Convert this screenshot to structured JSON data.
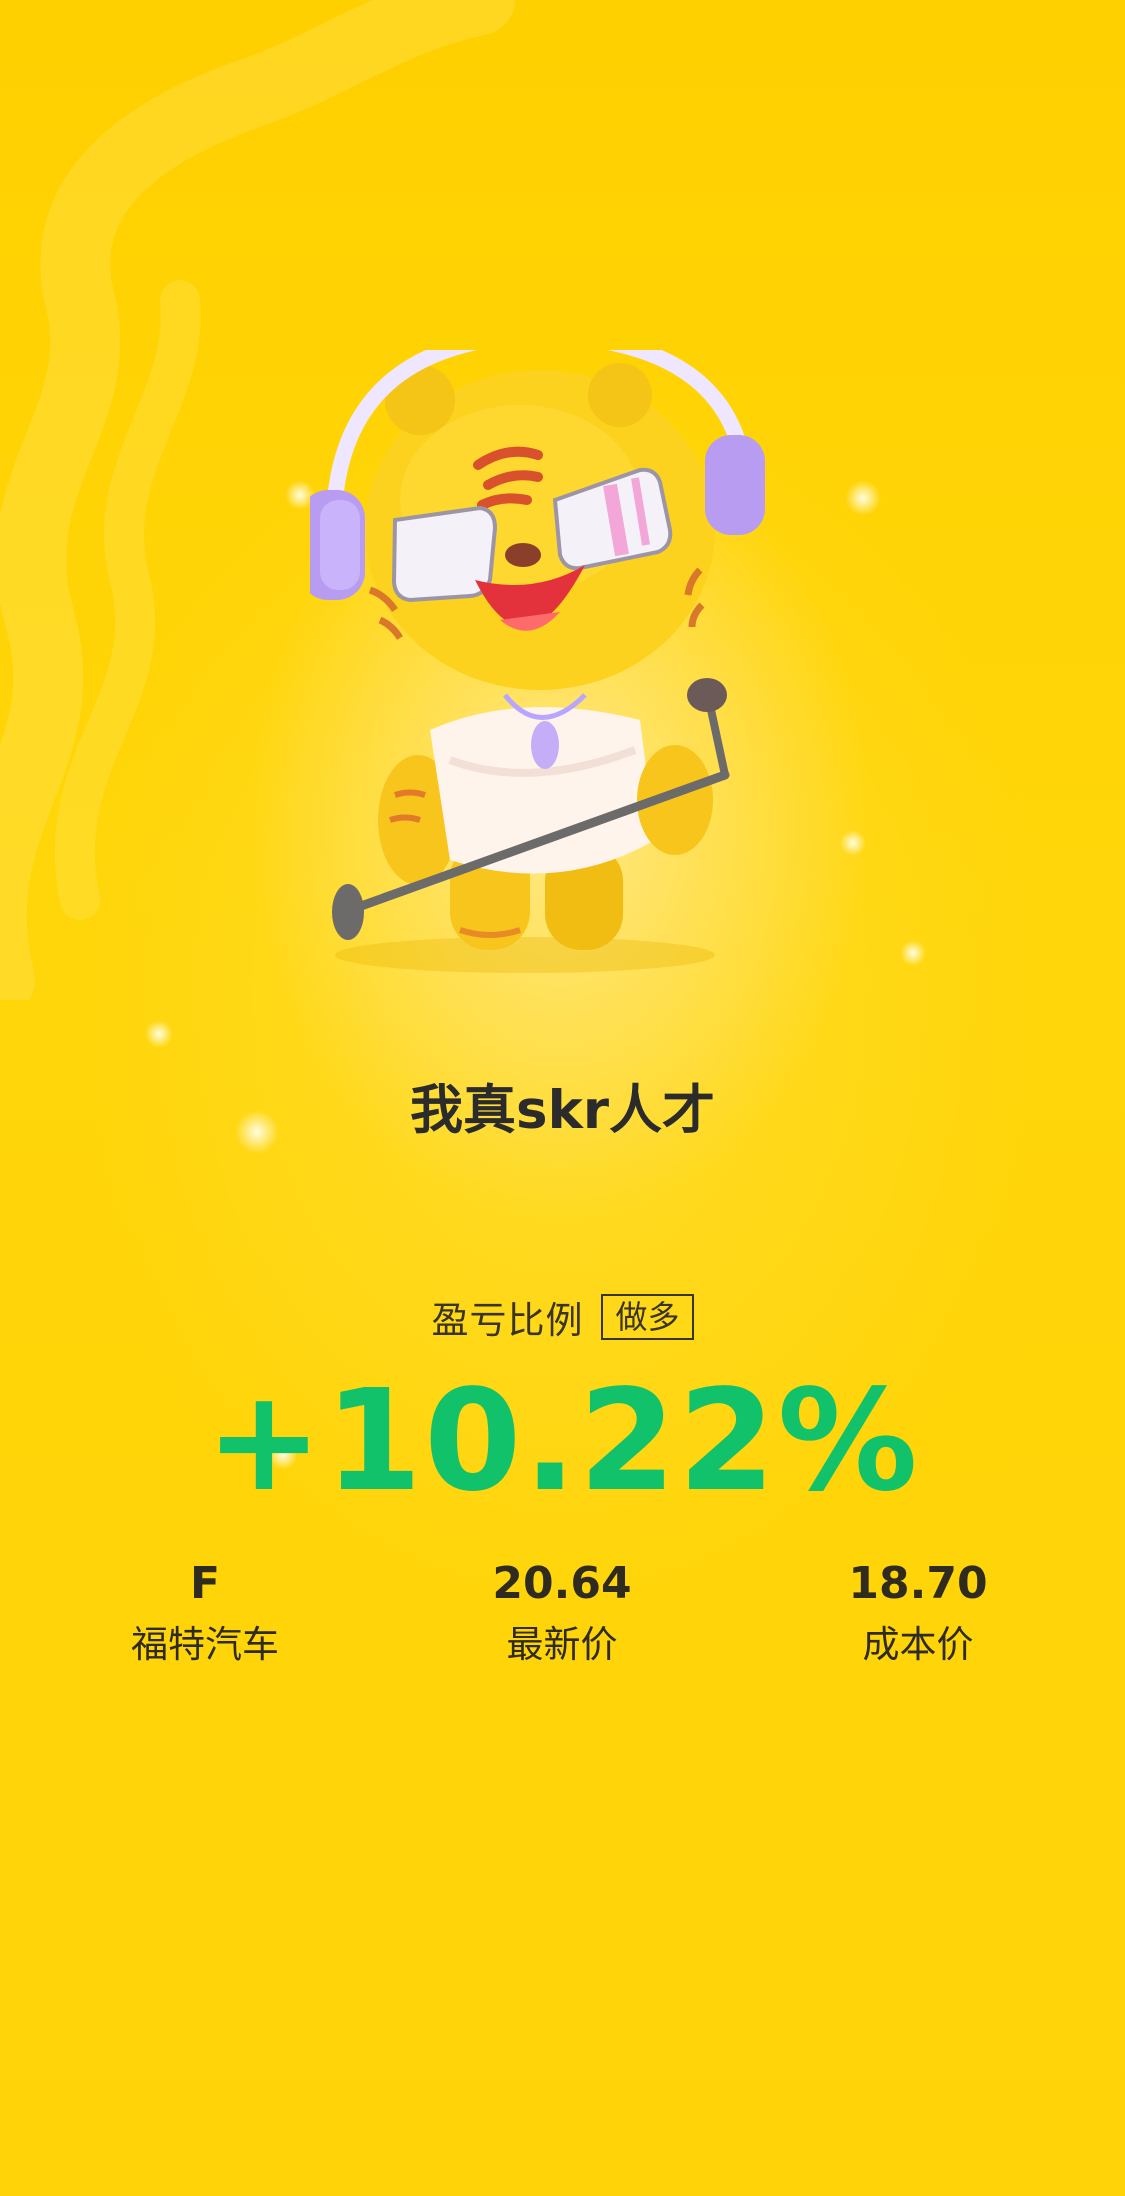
{
  "slogan": "我真skr人才",
  "ratio": {
    "label": "盈亏比例",
    "direction": "做多",
    "value": "+10.22%"
  },
  "stats": [
    {
      "value": "F",
      "label": "福特汽车"
    },
    {
      "value": "20.64",
      "label": "最新价"
    },
    {
      "value": "18.70",
      "label": "成本价"
    }
  ],
  "colors": {
    "background": "#ffd60a",
    "gain": "#12c26b",
    "text": "#2e2a1c"
  },
  "illustration": "tiger-mascot-singing-with-headphones-and-microphone"
}
